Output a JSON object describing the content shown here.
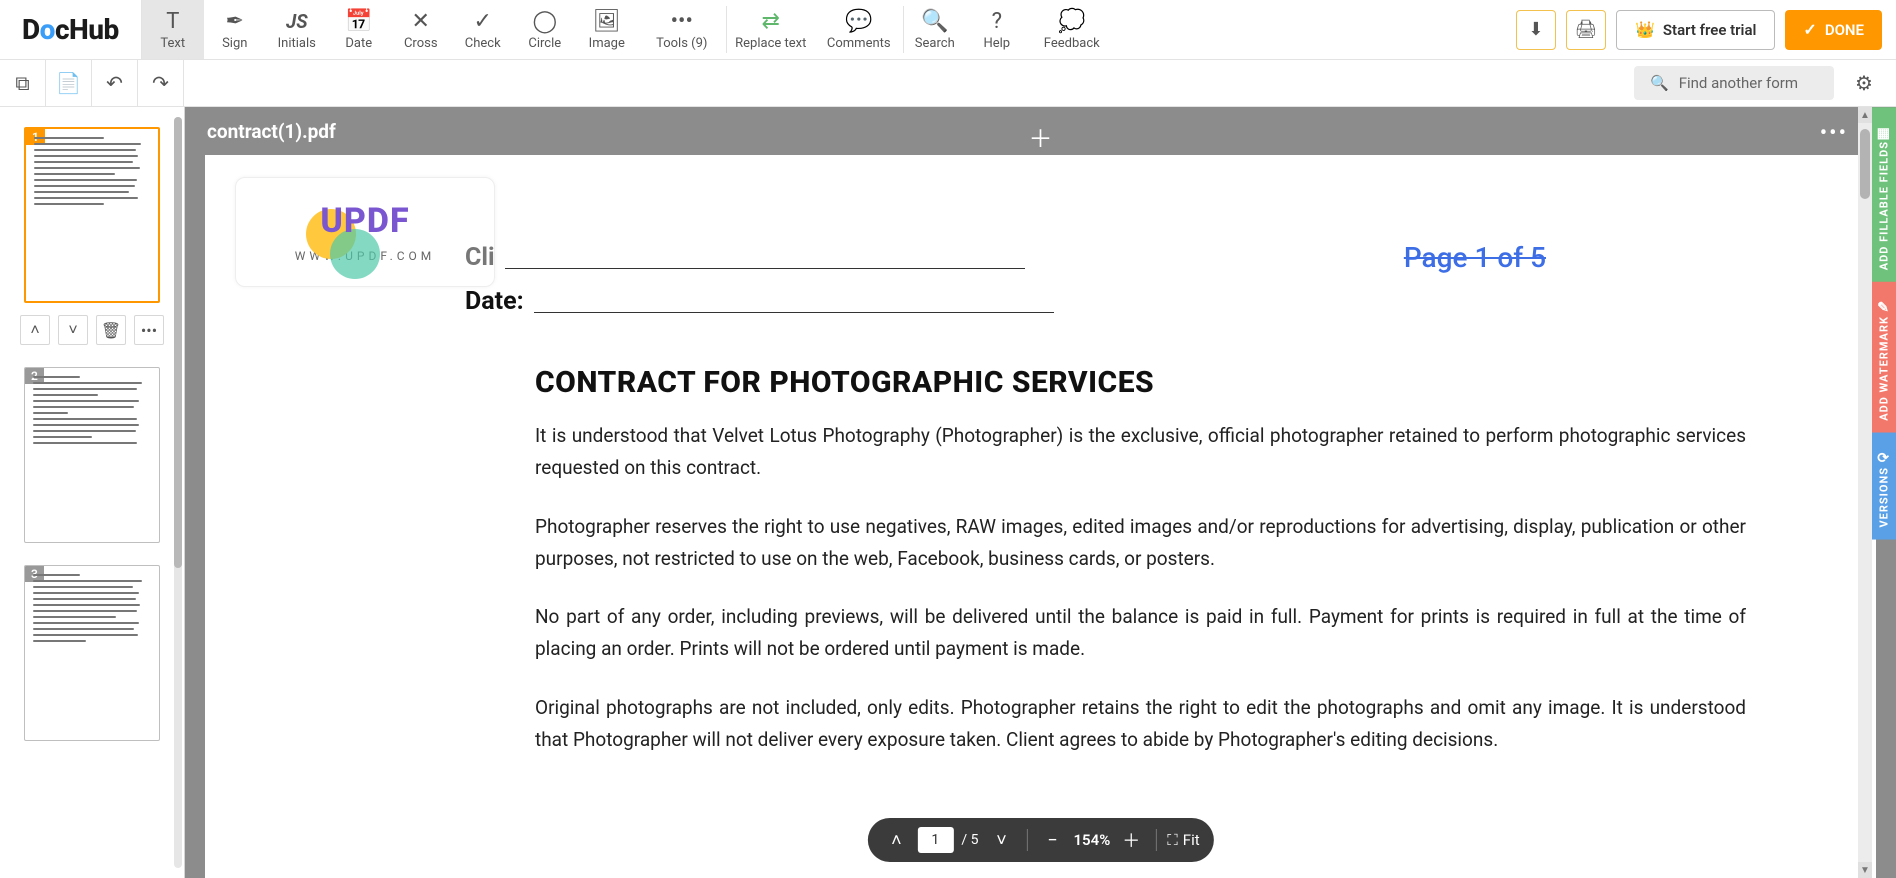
{
  "logo": {
    "text": "DocHub"
  },
  "toolbar": {
    "text": "Text",
    "sign": "Sign",
    "initials": "Initials",
    "date": "Date",
    "cross": "Cross",
    "check": "Check",
    "circle": "Circle",
    "image": "Image",
    "tools": "Tools (9)",
    "replace": "Replace text",
    "comments": "Comments",
    "search": "Search",
    "help": "Help",
    "feedback": "Feedback",
    "trial": "Start free trial",
    "done": "DONE"
  },
  "subbar": {
    "find": "Find another form"
  },
  "thumbs": {
    "p1": "1",
    "p2": "2",
    "p3": "3"
  },
  "tab": {
    "name": "contract(1).pdf"
  },
  "watermark": {
    "big": "UPDF",
    "url": "WWW.UPDF.COM"
  },
  "page": {
    "indicator": "Page 1 of 5",
    "client_label": "Cli",
    "date_label": "Date:",
    "title": "CONTRACT FOR PHOTOGRAPHIC SERVICES",
    "p1": "It is understood that Velvet Lotus Photography (Photographer) is the exclusive, official photographer retained to perform photographic services requested on this contract.",
    "p2": "Photographer reserves the right to use negatives, RAW images, edited images and/or reproductions for advertising, display, publication or other purposes, not restricted to use on the web, Facebook, business cards, or posters.",
    "p3": "No part of any order, including previews, will be delivered until the balance is paid in full. Payment for prints is required in full at the time of placing an order. Prints will not be ordered until payment is made.",
    "p4": "Original photographs are not included, only edits. Photographer retains the right to edit the photographs and omit any image. It is understood that Photographer will not deliver every exposure taken. Client agrees to abide by Photographer's editing decisions."
  },
  "zoom": {
    "page": "1",
    "of": "/ 5",
    "pct": "154%",
    "fit": "Fit"
  },
  "rails": {
    "fields": "ADD FILLABLE FIELDS",
    "watermark": "ADD WATERMARK",
    "versions": "VERSIONS"
  }
}
